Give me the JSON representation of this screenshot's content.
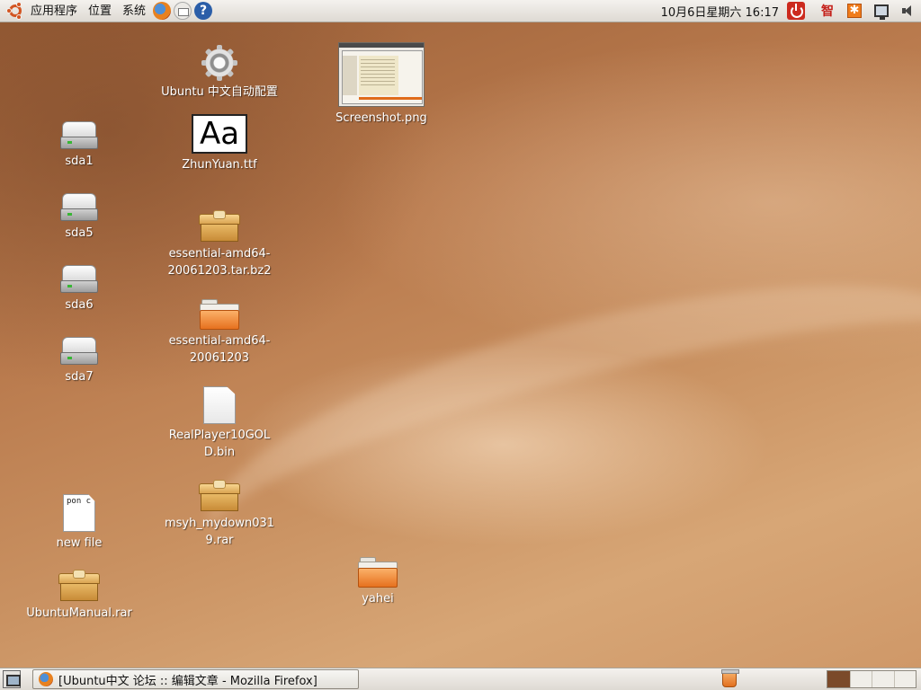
{
  "top_panel": {
    "menus": [
      "应用程序",
      "位置",
      "系统"
    ],
    "launchers": [
      "firefox-icon",
      "mail-icon",
      "help-icon"
    ],
    "clock": "10月6日星期六 16:17",
    "tray": [
      "power-icon",
      "ime-icon",
      "update-icon",
      "network-icon",
      "volume-icon"
    ],
    "ime_glyph": "智",
    "update_glyph": "✱"
  },
  "desktop": {
    "icons": [
      {
        "label": "Ubuntu 中文自动配置",
        "type": "gear"
      },
      {
        "label": "Screenshot.png",
        "type": "image"
      },
      {
        "label": "sda1",
        "type": "drive"
      },
      {
        "label": "ZhunYuan.ttf",
        "type": "font",
        "glyph": "Aa"
      },
      {
        "label": "sda5",
        "type": "drive"
      },
      {
        "label": "essential-amd64-20061203.tar.bz2",
        "type": "package"
      },
      {
        "label": "sda6",
        "type": "drive"
      },
      {
        "label": "essential-amd64-20061203",
        "type": "folder"
      },
      {
        "label": "sda7",
        "type": "drive"
      },
      {
        "label": "RealPlayer10GOLD.bin",
        "type": "blank"
      },
      {
        "label": "msyh_mydown0319.rar",
        "type": "package"
      },
      {
        "label": "new file",
        "type": "text",
        "content": "pon c"
      },
      {
        "label": "UbuntuManual.rar",
        "type": "package"
      },
      {
        "label": "yahei",
        "type": "folder"
      }
    ]
  },
  "bottom_panel": {
    "task": "[Ubuntu中文 论坛 :: 编辑文章 - Mozilla Firefox]",
    "workspaces": 4,
    "active_workspace": 1
  }
}
